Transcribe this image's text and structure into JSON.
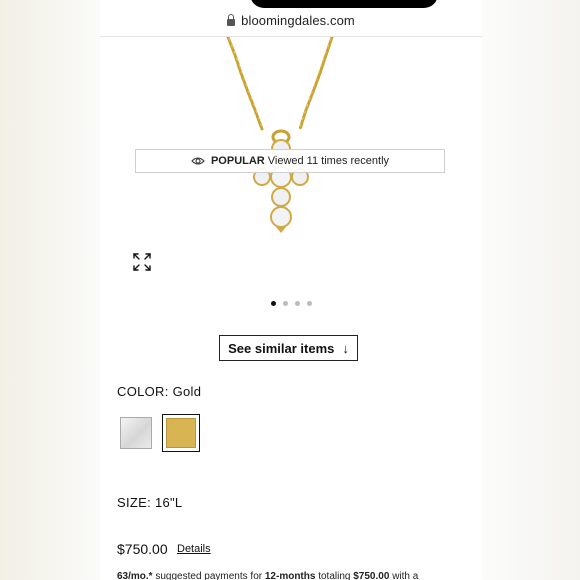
{
  "browser": {
    "url": "bloomingdales.com"
  },
  "product_image": {
    "popular_label": "POPULAR",
    "popular_text": "Viewed 11 times recently",
    "carousel_total": 4,
    "carousel_active": 1
  },
  "similar_button": {
    "label": "See similar items",
    "arrow": "↓"
  },
  "color": {
    "label": "COLOR:",
    "value": "Gold",
    "swatches": [
      "silver",
      "gold"
    ],
    "selected": "gold",
    "gold_hex": "#d8b552"
  },
  "size": {
    "label": "SIZE:",
    "value": "16\"L"
  },
  "price": {
    "amount": "$750.00",
    "details_link": "Details"
  },
  "financing": {
    "monthly": "63/mo.*",
    "text1": "suggested payments for",
    "term": "12-months",
    "text2": "totaling",
    "total": "$750.00",
    "text3": "with a"
  }
}
